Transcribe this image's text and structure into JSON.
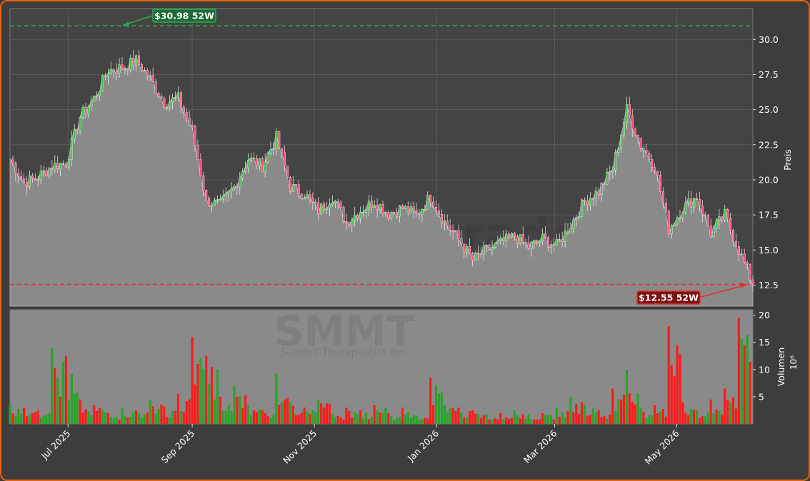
{
  "chart_data": {
    "type": "candlestick",
    "ticker": "SMMT",
    "company": "Summit Therapeutics Inc.",
    "watermark": "forexsignale.trade",
    "price_axis_label": "Preis",
    "volume_axis_label": "Volumen",
    "volume_axis_unit": "10⁶",
    "price_ticks": [
      12.5,
      15.0,
      17.5,
      20.0,
      22.5,
      25.0,
      27.5,
      30.0
    ],
    "price_ylim": [
      11.0,
      32.2
    ],
    "volume_ticks": [
      5,
      10,
      15,
      20
    ],
    "volume_ylim": [
      0,
      21
    ],
    "x_tick_labels": [
      "Jul 2025",
      "Sep 2025",
      "Nov 2025",
      "Jan 2026",
      "Mar 2026",
      "May 2026"
    ],
    "x_tick_dates": [
      "2025-07-01",
      "2025-09-01",
      "2025-11-01",
      "2026-01-01",
      "2026-03-01",
      "2026-05-01"
    ],
    "date_range": [
      "2025-06-02",
      "2026-06-08"
    ],
    "high_52w": {
      "value": 30.98,
      "label": "$30.98 52W",
      "date": "2025-07-28",
      "color": "#2fa84f"
    },
    "low_52w": {
      "value": 12.55,
      "label": "$12.55 52W",
      "date": "2026-06-05",
      "color": "#e03030"
    },
    "colors": {
      "up": "#28a428",
      "down": "#ff1a1a",
      "area": "#8a8a8a",
      "background": "#3d3d3d",
      "frame": "#e8620e"
    },
    "close_series": [
      [
        "2025-06-02",
        21.5
      ],
      [
        "2025-06-09",
        19.8
      ],
      [
        "2025-06-16",
        20.2
      ],
      [
        "2025-06-23",
        21.0
      ],
      [
        "2025-06-30",
        21.2
      ],
      [
        "2025-07-07",
        24.5
      ],
      [
        "2025-07-14",
        25.8
      ],
      [
        "2025-07-21",
        27.8
      ],
      [
        "2025-07-28",
        28.0
      ],
      [
        "2025-08-04",
        28.5
      ],
      [
        "2025-08-11",
        27.2
      ],
      [
        "2025-08-18",
        25.5
      ],
      [
        "2025-08-25",
        25.8
      ],
      [
        "2025-09-01",
        23.5
      ],
      [
        "2025-09-08",
        18.5
      ],
      [
        "2025-09-15",
        18.2
      ],
      [
        "2025-09-22",
        19.5
      ],
      [
        "2025-09-29",
        21.5
      ],
      [
        "2025-10-06",
        21.0
      ],
      [
        "2025-10-13",
        23.0
      ],
      [
        "2025-10-20",
        19.5
      ],
      [
        "2025-10-27",
        19.0
      ],
      [
        "2025-11-03",
        17.8
      ],
      [
        "2025-11-10",
        18.8
      ],
      [
        "2025-11-17",
        17.0
      ],
      [
        "2025-11-24",
        17.8
      ],
      [
        "2025-12-01",
        18.5
      ],
      [
        "2025-12-08",
        17.6
      ],
      [
        "2025-12-15",
        18.0
      ],
      [
        "2025-12-22",
        17.5
      ],
      [
        "2025-12-29",
        18.8
      ],
      [
        "2026-01-05",
        17.0
      ],
      [
        "2026-01-12",
        15.8
      ],
      [
        "2026-01-19",
        14.3
      ],
      [
        "2026-01-26",
        15.0
      ],
      [
        "2026-02-02",
        15.5
      ],
      [
        "2026-02-09",
        16.0
      ],
      [
        "2026-02-16",
        15.2
      ],
      [
        "2026-02-23",
        15.8
      ],
      [
        "2026-03-02",
        15.3
      ],
      [
        "2026-03-09",
        16.8
      ],
      [
        "2026-03-16",
        18.5
      ],
      [
        "2026-03-23",
        19.2
      ],
      [
        "2026-03-30",
        20.8
      ],
      [
        "2026-04-06",
        25.0
      ],
      [
        "2026-04-13",
        22.5
      ],
      [
        "2026-04-20",
        21.0
      ],
      [
        "2026-04-27",
        16.5
      ],
      [
        "2026-05-04",
        18.0
      ],
      [
        "2026-05-11",
        18.8
      ],
      [
        "2026-05-18",
        16.2
      ],
      [
        "2026-05-25",
        17.5
      ],
      [
        "2026-06-01",
        15.0
      ],
      [
        "2026-06-08",
        12.6
      ]
    ],
    "volume_series": [
      [
        "2025-06-02",
        3.5
      ],
      [
        "2025-06-09",
        3.0
      ],
      [
        "2025-06-16",
        2.5
      ],
      [
        "2025-06-23",
        14.0
      ],
      [
        "2025-06-30",
        12.5
      ],
      [
        "2025-07-07",
        4.5
      ],
      [
        "2025-07-14",
        3.5
      ],
      [
        "2025-07-21",
        2.0
      ],
      [
        "2025-07-28",
        3.0
      ],
      [
        "2025-08-04",
        2.5
      ],
      [
        "2025-08-11",
        4.5
      ],
      [
        "2025-08-18",
        3.2
      ],
      [
        "2025-08-25",
        5.5
      ],
      [
        "2025-09-01",
        16.0
      ],
      [
        "2025-09-08",
        12.5
      ],
      [
        "2025-09-15",
        5.0
      ],
      [
        "2025-09-22",
        7.0
      ],
      [
        "2025-09-29",
        3.5
      ],
      [
        "2025-10-06",
        2.5
      ],
      [
        "2025-10-13",
        9.2
      ],
      [
        "2025-10-20",
        4.0
      ],
      [
        "2025-10-27",
        3.0
      ],
      [
        "2025-11-03",
        4.5
      ],
      [
        "2025-11-10",
        2.0
      ],
      [
        "2025-11-17",
        3.0
      ],
      [
        "2025-11-24",
        2.5
      ],
      [
        "2025-12-01",
        3.5
      ],
      [
        "2025-12-08",
        2.0
      ],
      [
        "2025-12-15",
        3.0
      ],
      [
        "2025-12-22",
        1.5
      ],
      [
        "2025-12-29",
        8.5
      ],
      [
        "2026-01-05",
        3.5
      ],
      [
        "2026-01-12",
        3.0
      ],
      [
        "2026-01-19",
        2.5
      ],
      [
        "2026-01-26",
        1.8
      ],
      [
        "2026-02-02",
        2.0
      ],
      [
        "2026-02-09",
        2.5
      ],
      [
        "2026-02-16",
        1.8
      ],
      [
        "2026-02-23",
        2.0
      ],
      [
        "2026-03-02",
        3.0
      ],
      [
        "2026-03-09",
        5.0
      ],
      [
        "2026-03-16",
        3.5
      ],
      [
        "2026-03-23",
        2.5
      ],
      [
        "2026-03-30",
        6.5
      ],
      [
        "2026-04-06",
        10.0
      ],
      [
        "2026-04-13",
        3.0
      ],
      [
        "2026-04-20",
        3.5
      ],
      [
        "2026-04-27",
        18.0
      ],
      [
        "2026-05-04",
        4.0
      ],
      [
        "2026-05-11",
        2.5
      ],
      [
        "2026-05-18",
        4.5
      ],
      [
        "2026-05-25",
        6.5
      ],
      [
        "2026-06-01",
        19.5
      ],
      [
        "2026-06-08",
        8.5
      ]
    ]
  }
}
